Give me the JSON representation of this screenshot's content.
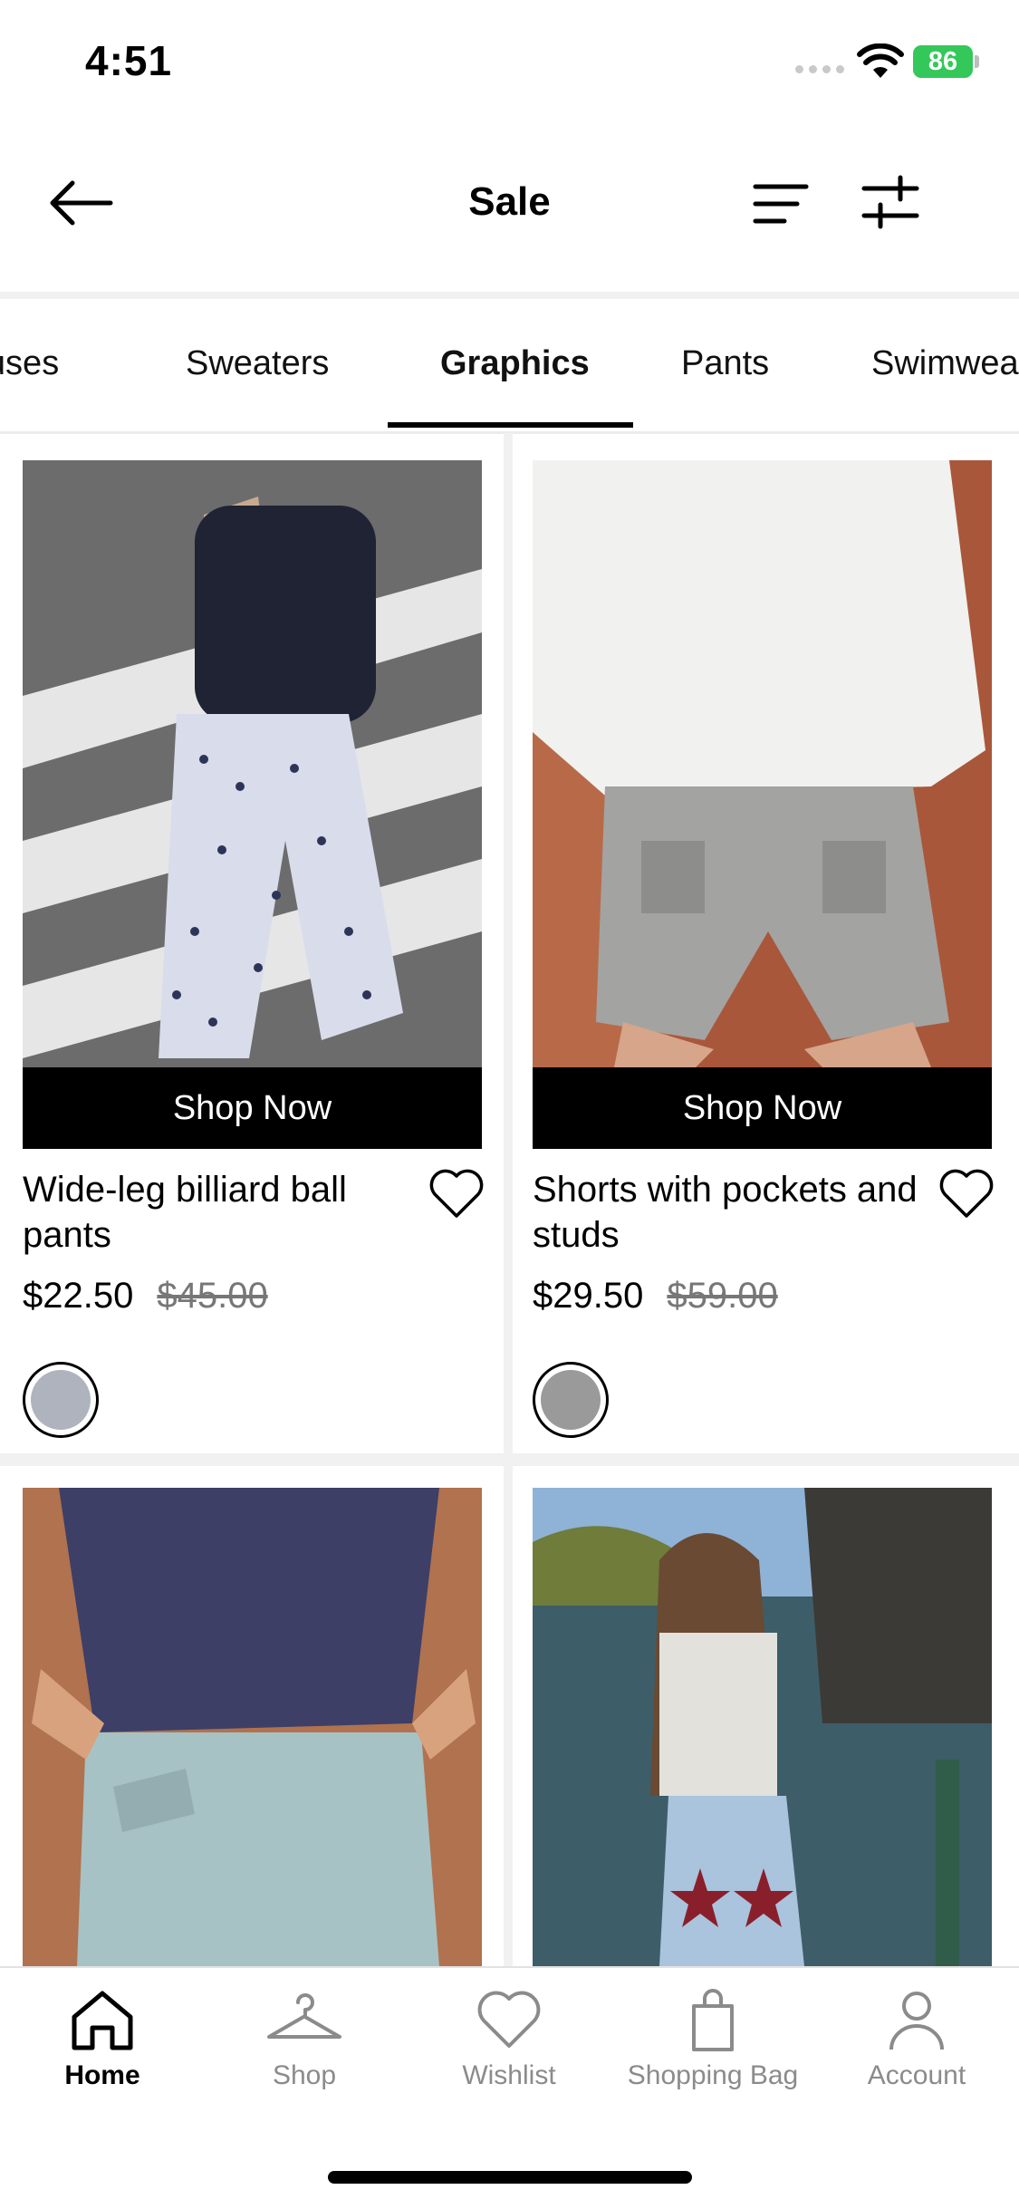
{
  "status_bar": {
    "time": "4:51",
    "battery": "86"
  },
  "header": {
    "title": "Sale"
  },
  "tabs": [
    {
      "label": "Blouses"
    },
    {
      "label": "Sweaters"
    },
    {
      "label": "Graphics",
      "active": true
    },
    {
      "label": "Pants"
    },
    {
      "label": "Swimwear"
    }
  ],
  "products": [
    {
      "name": "Wide-leg billiard ball pants",
      "cta": "Shop Now",
      "price": "$22.50",
      "original_price": "$45.00",
      "swatch_color": "#aeb3bd"
    },
    {
      "name": "Shorts with pockets and studs",
      "cta": "Shop Now",
      "price": "$29.50",
      "original_price": "$59.00",
      "swatch_color": "#9a9a9a"
    },
    {
      "cta": ""
    },
    {
      "cta": ""
    }
  ],
  "bottom_nav": [
    {
      "label": "Home",
      "icon": "home-icon",
      "active": true
    },
    {
      "label": "Shop",
      "icon": "hanger-icon"
    },
    {
      "label": "Wishlist",
      "icon": "heart-icon"
    },
    {
      "label": "Shopping Bag",
      "icon": "bag-icon"
    },
    {
      "label": "Account",
      "icon": "person-icon"
    }
  ],
  "colors": {
    "accent": "#000000",
    "battery": "#34c759",
    "muted_text": "#8b8b8b"
  }
}
